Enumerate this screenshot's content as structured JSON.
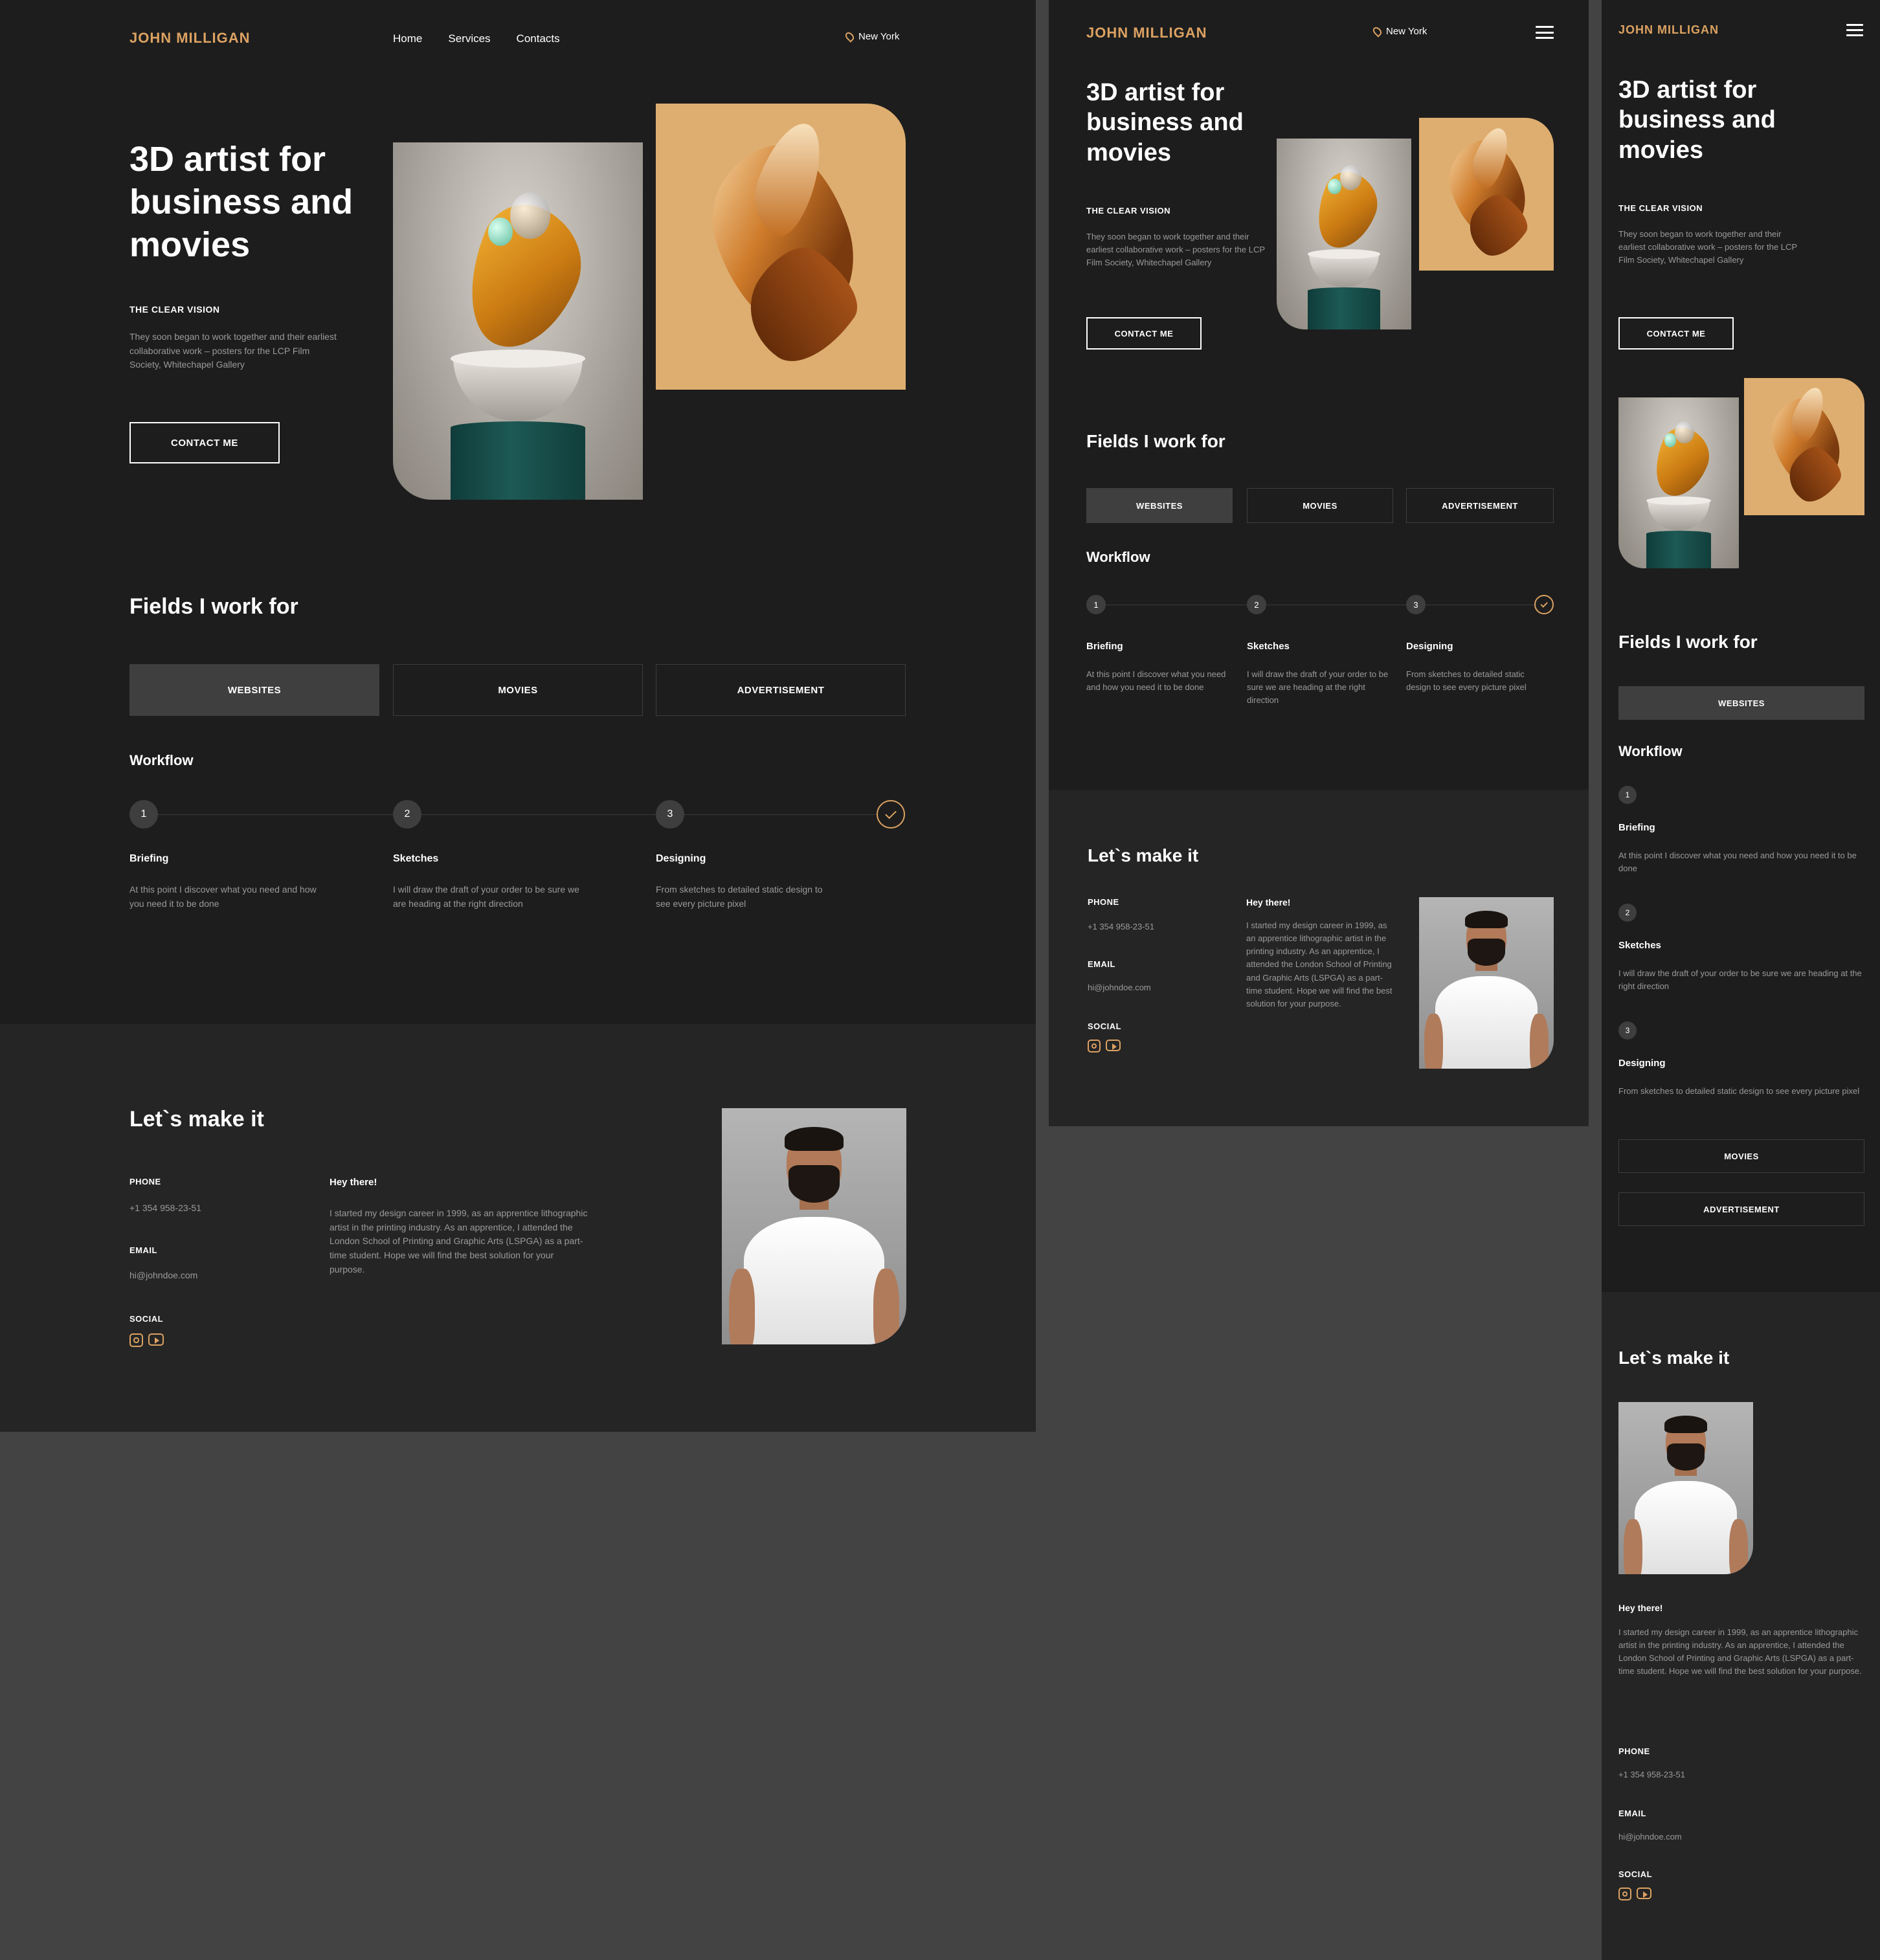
{
  "brand": {
    "logo": "JOHN MILLIGAN",
    "accent": "#dca262"
  },
  "nav": {
    "home": "Home",
    "services": "Services",
    "contacts": "Contacts"
  },
  "location": "New York",
  "hero": {
    "title": "3D artist for business and movies",
    "eyebrow": "THE CLEAR VISION",
    "text": "They soon began to work together and their earliest collaborative work – posters for the LCP Film Society, Whitechapel Gallery",
    "cta": "CONTACT ME"
  },
  "fields": {
    "title": "Fields I work for",
    "tabs": [
      "WEBSITES",
      "MOVIES",
      "ADVERTISEMENT"
    ]
  },
  "workflow": {
    "title": "Workflow",
    "steps": [
      {
        "num": "1",
        "title": "Briefing",
        "text": "At this point I discover what you need and how you need it to be done"
      },
      {
        "num": "2",
        "title": "Sketches",
        "text": "I will draw the draft of your order to be sure we are heading at the right direction"
      },
      {
        "num": "3",
        "title": "Designing",
        "text": "From sketches to detailed static design to see every picture pixel"
      }
    ]
  },
  "contact": {
    "title": "Let`s make it",
    "phone_label": "PHONE",
    "phone": "+1 354 958-23-51",
    "email_label": "EMAIL",
    "email": "hi@johndoe.com",
    "social_label": "SOCIAL",
    "greeting": "Hey there!",
    "bio": "I started my design career in 1999, as an apprentice lithographic artist in the printing industry. As an apprentice, I attended the London School of Printing and Graphic Arts (LSPGA) as a part-time student. Hope we will find the best solution for your purpose."
  },
  "icons": [
    "location-pin-icon",
    "menu-icon",
    "instagram-icon",
    "youtube-icon",
    "check-icon"
  ]
}
